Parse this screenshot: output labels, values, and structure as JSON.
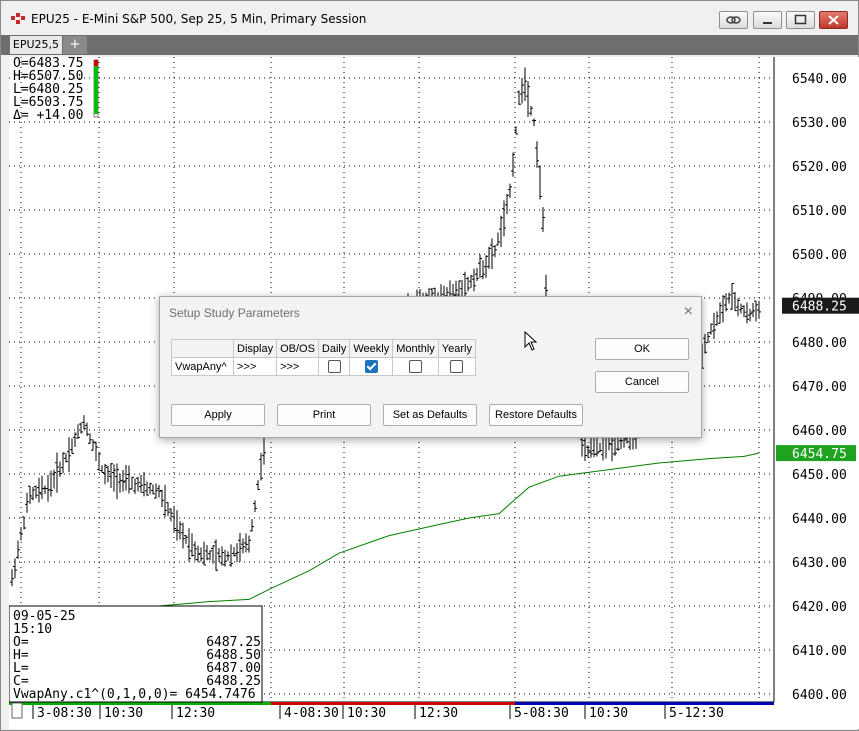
{
  "window": {
    "title": "EPU25 - E-Mini S&P 500, Sep 25, 5 Min, Primary Session",
    "tabs": [
      "EPU25,5"
    ],
    "add_tab": "+"
  },
  "chart_data": {
    "type": "bar",
    "series": [
      {
        "name": "EPU25 5 Min OHLC"
      },
      {
        "name": "VwapAny"
      }
    ],
    "ylim": [
      6400,
      6545
    ],
    "y_ticks": [
      "6540.00",
      "6530.00",
      "6520.00",
      "6510.00",
      "6500.00",
      "6490.00",
      "6480.00",
      "6470.00",
      "6460.00",
      "6450.00",
      "6440.00",
      "6430.00",
      "6420.00",
      "6410.00",
      "6400.00"
    ],
    "x_ticks": [
      "3-08:30",
      "10:30",
      "12:30",
      "4-08:30",
      "10:30",
      "12:30",
      "5-08:30",
      "10:30",
      "5-12:30"
    ],
    "last_price_label": "6488.25",
    "vwap_label": "6454.75",
    "grid": true,
    "session_bar_colors": [
      "#00b000",
      "#cc0000",
      "#0000b0"
    ]
  },
  "ohlc_box": {
    "lines": [
      "O=6483.75",
      "H=6507.50",
      "L=6480.25",
      "L=6503.75",
      "Δ= +14.00"
    ]
  },
  "data_window": {
    "date": "09-05-25",
    "time": "15:10",
    "rows": [
      {
        "label": "O=",
        "value": "6487.25"
      },
      {
        "label": "H=",
        "value": "6488.50"
      },
      {
        "label": "L=",
        "value": "6487.00"
      },
      {
        "label": "C=",
        "value": "6488.25"
      }
    ],
    "study_line": "VwapAny.c1^(0,1,0,0)= 6454.7476"
  },
  "dialog": {
    "title": "Setup Study Parameters",
    "close": "×",
    "columns": [
      "Display",
      "OB/OS",
      "Daily",
      "Weekly",
      "Monthly",
      "Yearly"
    ],
    "row": {
      "name": "VwapAny^",
      "display": ">>>",
      "obos": ">>>",
      "daily": false,
      "weekly": true,
      "monthly": false,
      "yearly": false
    },
    "buttons": {
      "ok": "OK",
      "cancel": "Cancel",
      "apply": "Apply",
      "print": "Print",
      "set_defaults": "Set as Defaults",
      "restore_defaults": "Restore Defaults"
    }
  },
  "colors": {
    "bars": "#000000",
    "vwap": "#008000",
    "last_price_bg": "#1a1a1a",
    "vwap_bg": "#1fa21f"
  }
}
